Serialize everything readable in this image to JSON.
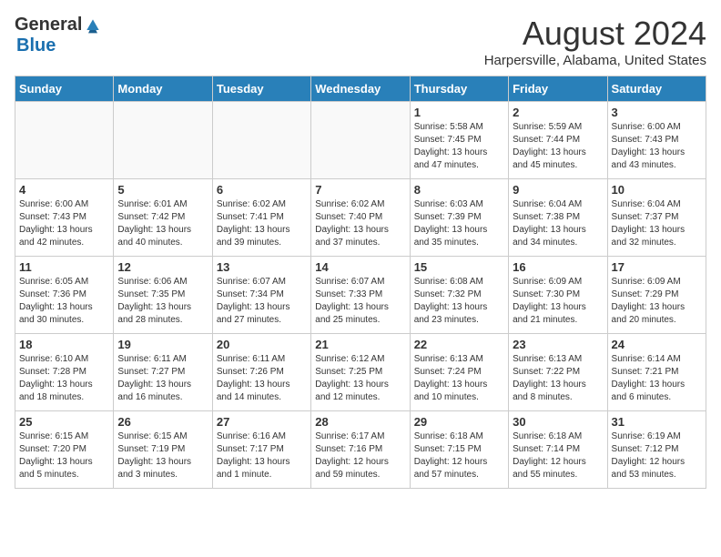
{
  "header": {
    "logo_general": "General",
    "logo_blue": "Blue",
    "month_title": "August 2024",
    "location": "Harpersville, Alabama, United States"
  },
  "weekdays": [
    "Sunday",
    "Monday",
    "Tuesday",
    "Wednesday",
    "Thursday",
    "Friday",
    "Saturday"
  ],
  "weeks": [
    [
      {
        "day": "",
        "info": ""
      },
      {
        "day": "",
        "info": ""
      },
      {
        "day": "",
        "info": ""
      },
      {
        "day": "",
        "info": ""
      },
      {
        "day": "1",
        "info": "Sunrise: 5:58 AM\nSunset: 7:45 PM\nDaylight: 13 hours\nand 47 minutes."
      },
      {
        "day": "2",
        "info": "Sunrise: 5:59 AM\nSunset: 7:44 PM\nDaylight: 13 hours\nand 45 minutes."
      },
      {
        "day": "3",
        "info": "Sunrise: 6:00 AM\nSunset: 7:43 PM\nDaylight: 13 hours\nand 43 minutes."
      }
    ],
    [
      {
        "day": "4",
        "info": "Sunrise: 6:00 AM\nSunset: 7:43 PM\nDaylight: 13 hours\nand 42 minutes."
      },
      {
        "day": "5",
        "info": "Sunrise: 6:01 AM\nSunset: 7:42 PM\nDaylight: 13 hours\nand 40 minutes."
      },
      {
        "day": "6",
        "info": "Sunrise: 6:02 AM\nSunset: 7:41 PM\nDaylight: 13 hours\nand 39 minutes."
      },
      {
        "day": "7",
        "info": "Sunrise: 6:02 AM\nSunset: 7:40 PM\nDaylight: 13 hours\nand 37 minutes."
      },
      {
        "day": "8",
        "info": "Sunrise: 6:03 AM\nSunset: 7:39 PM\nDaylight: 13 hours\nand 35 minutes."
      },
      {
        "day": "9",
        "info": "Sunrise: 6:04 AM\nSunset: 7:38 PM\nDaylight: 13 hours\nand 34 minutes."
      },
      {
        "day": "10",
        "info": "Sunrise: 6:04 AM\nSunset: 7:37 PM\nDaylight: 13 hours\nand 32 minutes."
      }
    ],
    [
      {
        "day": "11",
        "info": "Sunrise: 6:05 AM\nSunset: 7:36 PM\nDaylight: 13 hours\nand 30 minutes."
      },
      {
        "day": "12",
        "info": "Sunrise: 6:06 AM\nSunset: 7:35 PM\nDaylight: 13 hours\nand 28 minutes."
      },
      {
        "day": "13",
        "info": "Sunrise: 6:07 AM\nSunset: 7:34 PM\nDaylight: 13 hours\nand 27 minutes."
      },
      {
        "day": "14",
        "info": "Sunrise: 6:07 AM\nSunset: 7:33 PM\nDaylight: 13 hours\nand 25 minutes."
      },
      {
        "day": "15",
        "info": "Sunrise: 6:08 AM\nSunset: 7:32 PM\nDaylight: 13 hours\nand 23 minutes."
      },
      {
        "day": "16",
        "info": "Sunrise: 6:09 AM\nSunset: 7:30 PM\nDaylight: 13 hours\nand 21 minutes."
      },
      {
        "day": "17",
        "info": "Sunrise: 6:09 AM\nSunset: 7:29 PM\nDaylight: 13 hours\nand 20 minutes."
      }
    ],
    [
      {
        "day": "18",
        "info": "Sunrise: 6:10 AM\nSunset: 7:28 PM\nDaylight: 13 hours\nand 18 minutes."
      },
      {
        "day": "19",
        "info": "Sunrise: 6:11 AM\nSunset: 7:27 PM\nDaylight: 13 hours\nand 16 minutes."
      },
      {
        "day": "20",
        "info": "Sunrise: 6:11 AM\nSunset: 7:26 PM\nDaylight: 13 hours\nand 14 minutes."
      },
      {
        "day": "21",
        "info": "Sunrise: 6:12 AM\nSunset: 7:25 PM\nDaylight: 13 hours\nand 12 minutes."
      },
      {
        "day": "22",
        "info": "Sunrise: 6:13 AM\nSunset: 7:24 PM\nDaylight: 13 hours\nand 10 minutes."
      },
      {
        "day": "23",
        "info": "Sunrise: 6:13 AM\nSunset: 7:22 PM\nDaylight: 13 hours\nand 8 minutes."
      },
      {
        "day": "24",
        "info": "Sunrise: 6:14 AM\nSunset: 7:21 PM\nDaylight: 13 hours\nand 6 minutes."
      }
    ],
    [
      {
        "day": "25",
        "info": "Sunrise: 6:15 AM\nSunset: 7:20 PM\nDaylight: 13 hours\nand 5 minutes."
      },
      {
        "day": "26",
        "info": "Sunrise: 6:15 AM\nSunset: 7:19 PM\nDaylight: 13 hours\nand 3 minutes."
      },
      {
        "day": "27",
        "info": "Sunrise: 6:16 AM\nSunset: 7:17 PM\nDaylight: 13 hours\nand 1 minute."
      },
      {
        "day": "28",
        "info": "Sunrise: 6:17 AM\nSunset: 7:16 PM\nDaylight: 12 hours\nand 59 minutes."
      },
      {
        "day": "29",
        "info": "Sunrise: 6:18 AM\nSunset: 7:15 PM\nDaylight: 12 hours\nand 57 minutes."
      },
      {
        "day": "30",
        "info": "Sunrise: 6:18 AM\nSunset: 7:14 PM\nDaylight: 12 hours\nand 55 minutes."
      },
      {
        "day": "31",
        "info": "Sunrise: 6:19 AM\nSunset: 7:12 PM\nDaylight: 12 hours\nand 53 minutes."
      }
    ]
  ]
}
